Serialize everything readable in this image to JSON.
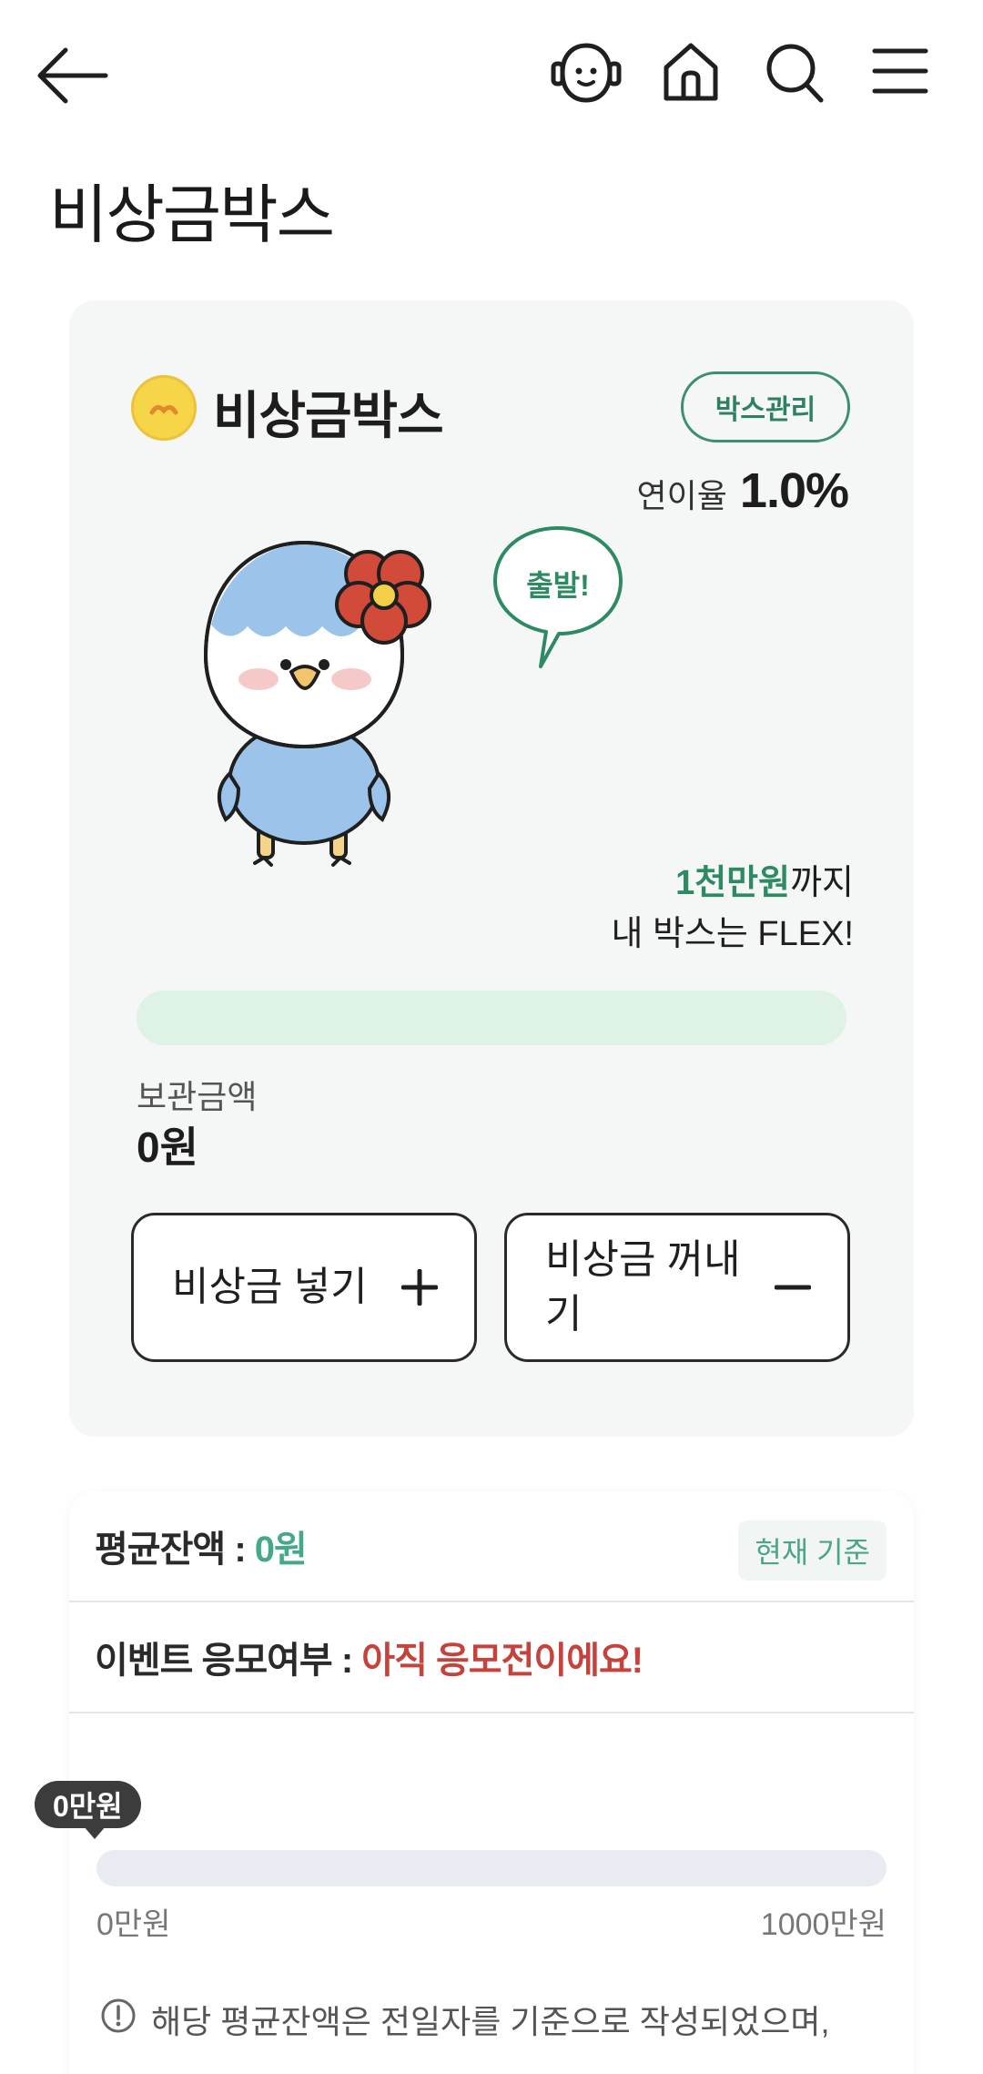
{
  "header": {
    "back_icon": "arrow-left-icon",
    "icons": [
      "chatbot-icon",
      "home-icon",
      "search-icon",
      "menu-icon"
    ]
  },
  "page_title": "비상금박스",
  "box": {
    "name": "비상금박스",
    "manage_label": "박스관리",
    "rate_label": "연이율",
    "rate_value": "1.0%",
    "bubble_text": "출발!",
    "goal_amount": "1천만원",
    "goal_suffix": "까지",
    "goal_line2": "내 박스는 FLEX!",
    "progress_fraction": 0,
    "stored_label": "보관금액",
    "stored_value": "0원",
    "deposit_label": "비상금 넣기",
    "withdraw_label": "비상금 꺼내기",
    "accent_color": "#2e8a62"
  },
  "info": {
    "avg_label": "평균잔액 :",
    "avg_value": "0원",
    "basis_chip": "현재 기준",
    "event_label": "이벤트 응모여부 :",
    "event_value": "아직 응모전이에요!",
    "tooltip": "0만원",
    "bar_fraction": 0,
    "scale_min": "0만원",
    "scale_max": "1000만원",
    "notice": "해당 평균잔액은 전일자를 기준으로 작성되었으며,"
  }
}
